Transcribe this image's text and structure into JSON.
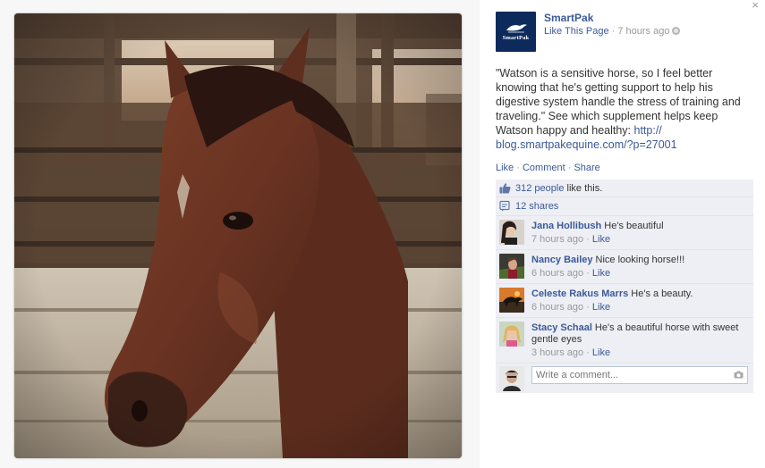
{
  "photo": {
    "subject": "horse-photo"
  },
  "close": {
    "glyph": "×"
  },
  "page": {
    "name": "SmartPak",
    "avatar_text": "SmartPak",
    "like_link": "Like This Page",
    "separator": " · ",
    "time": "7 hours ago"
  },
  "post": {
    "text": "\"Watson is a sensitive horse, so I feel better knowing that he's getting support to help his digestive system handle the stress of training and traveling.\" See which supplement helps keep Watson happy and healthy: ",
    "link": "http://\nblog.smartpakequine.com/?p=27001"
  },
  "actions": {
    "like": "Like",
    "comment": "Comment",
    "share": "Share",
    "separator": " · "
  },
  "stats": {
    "likes_count": "312 people",
    "likes_suffix": " like this.",
    "shares": "12 shares"
  },
  "comments": [
    {
      "author": "Jana Hollibush",
      "text": " He's beautiful",
      "time": "7 hours ago",
      "like": "Like"
    },
    {
      "author": "Nancy Bailey",
      "text": " Nice looking horse!!!",
      "time": "6 hours ago",
      "like": "Like"
    },
    {
      "author": "Celeste Rakus Marrs",
      "text": " He's a beauty.",
      "time": "6 hours ago",
      "like": "Like"
    },
    {
      "author": "Stacy Schaal",
      "text": " He's a beautiful horse with sweet gentle eyes",
      "time": "3 hours ago",
      "like": "Like"
    }
  ],
  "composer": {
    "placeholder": "Write a comment..."
  },
  "colors": {
    "link": "#3b5998",
    "muted": "#999999",
    "ufi_bg": "#edeff4",
    "brand_navy": "#0d2a5c"
  }
}
